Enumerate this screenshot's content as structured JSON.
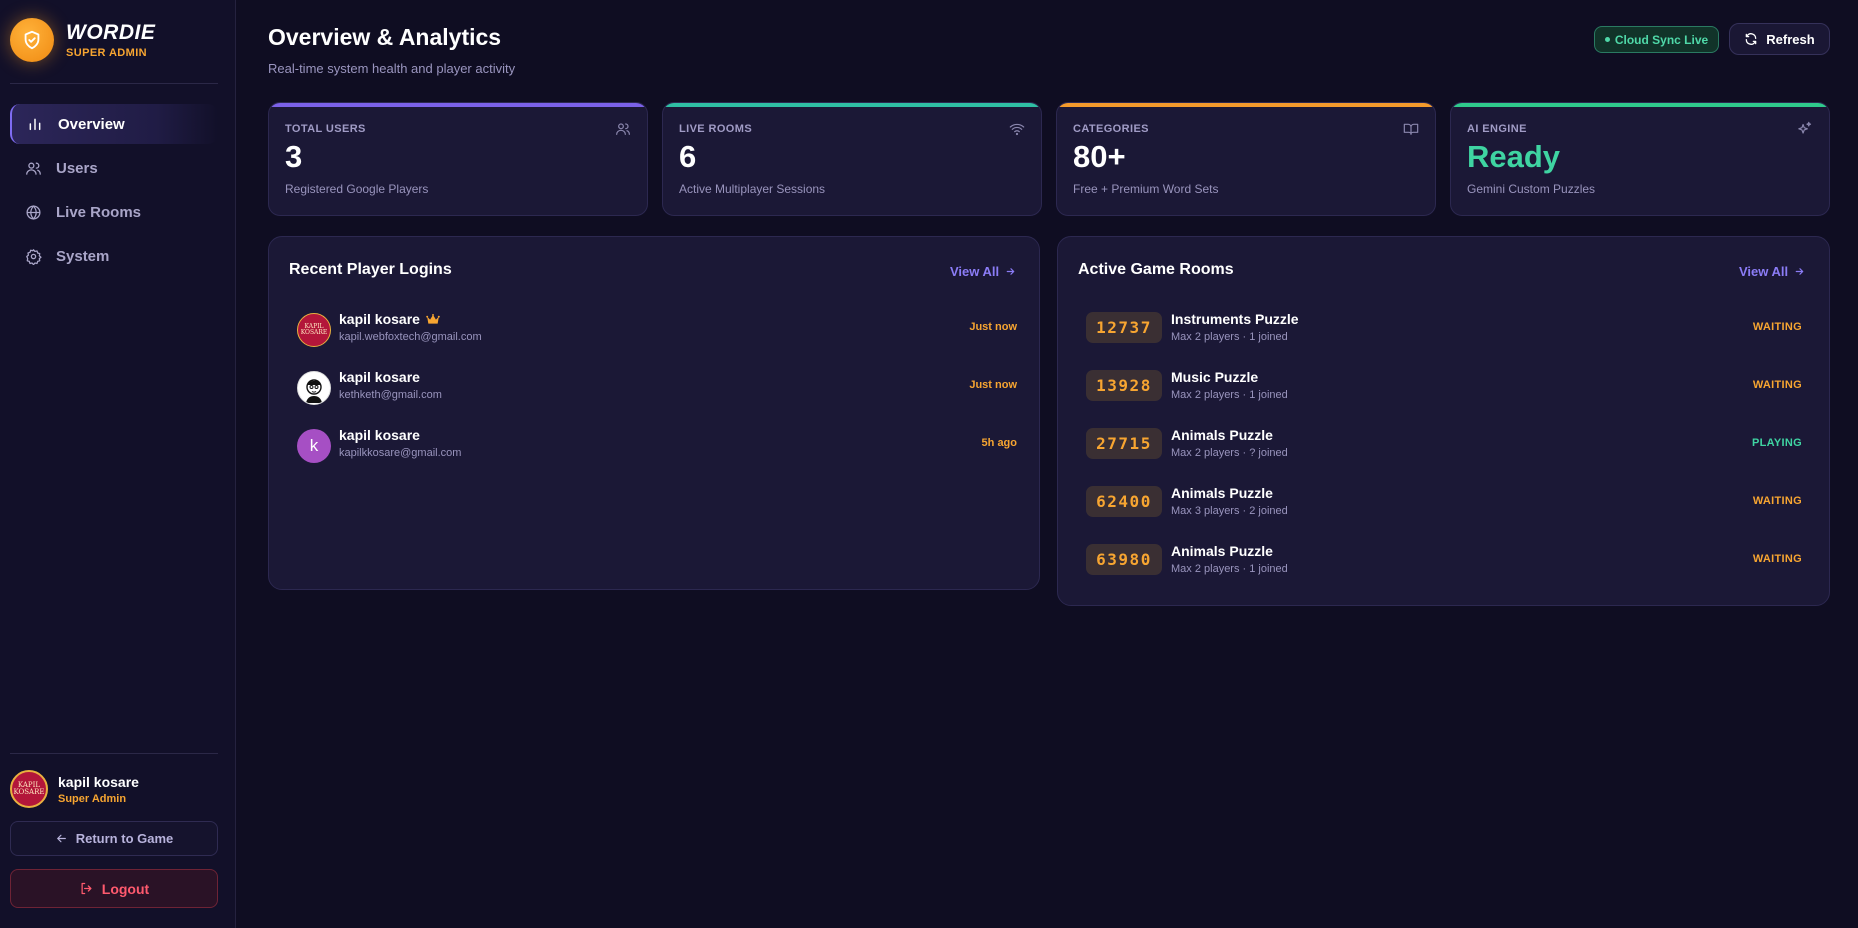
{
  "brand": {
    "name": "WORDIE",
    "role": "SUPER ADMIN"
  },
  "nav": [
    {
      "label": "Overview",
      "icon": "bar-chart-icon",
      "active": true
    },
    {
      "label": "Users",
      "icon": "users-icon",
      "active": false
    },
    {
      "label": "Live Rooms",
      "icon": "globe-icon",
      "active": false
    },
    {
      "label": "System",
      "icon": "gear-icon",
      "active": false
    }
  ],
  "current_user": {
    "name": "kapil kosare",
    "role": "Super Admin",
    "avatar_text": "KAPIL KOSARE"
  },
  "sidebar_actions": {
    "return_label": "Return to Game",
    "logout_label": "Logout"
  },
  "header": {
    "title": "Overview & Analytics",
    "subtitle": "Real-time system health and player activity",
    "sync_label": "Cloud Sync Live",
    "refresh_label": "Refresh"
  },
  "stats": [
    {
      "label": "TOTAL USERS",
      "value": "3",
      "desc": "Registered Google Players",
      "icon": "users-icon",
      "accent": "#7b61e8"
    },
    {
      "label": "LIVE ROOMS",
      "value": "6",
      "desc": "Active Multiplayer Sessions",
      "icon": "wifi-icon",
      "accent": "#2fbfa4"
    },
    {
      "label": "CATEGORIES",
      "value": "80+",
      "desc": "Free + Premium Word Sets",
      "icon": "book-icon",
      "accent": "#f39a2c"
    },
    {
      "label": "AI ENGINE",
      "value": "Ready",
      "desc": "Gemini Custom Puzzles",
      "icon": "sparkles-icon",
      "accent": "#2fc98c"
    }
  ],
  "recent_logins": {
    "title": "Recent Player Logins",
    "view_all": "View All",
    "items": [
      {
        "name": "kapil kosare",
        "email": "kapil.webfoxtech@gmail.com",
        "time": "Just now",
        "crown": true,
        "avatar": "logo"
      },
      {
        "name": "kapil kosare",
        "email": "kethketh@gmail.com",
        "time": "Just now",
        "crown": false,
        "avatar": "sketch"
      },
      {
        "name": "kapil kosare",
        "email": "kapilkkosare@gmail.com",
        "time": "5h ago",
        "crown": false,
        "avatar": "letter",
        "initial": "k"
      }
    ]
  },
  "active_rooms": {
    "title": "Active Game Rooms",
    "view_all": "View All",
    "items": [
      {
        "code": "12737",
        "name": "Instruments Puzzle",
        "meta": "Max 2 players · 1 joined",
        "status": "WAITING"
      },
      {
        "code": "13928",
        "name": "Music Puzzle",
        "meta": "Max 2 players · 1 joined",
        "status": "WAITING"
      },
      {
        "code": "27715",
        "name": "Animals Puzzle",
        "meta": "Max 2 players · ? joined",
        "status": "PLAYING"
      },
      {
        "code": "62400",
        "name": "Animals Puzzle",
        "meta": "Max 3 players · 2 joined",
        "status": "WAITING"
      },
      {
        "code": "63980",
        "name": "Animals Puzzle",
        "meta": "Max 2 players · 1 joined",
        "status": "WAITING"
      }
    ]
  },
  "colors": {
    "background": "#0f0d22",
    "accent_purple": "#8b7cf6",
    "accent_orange": "#f7a531",
    "status_waiting": "#f7a531",
    "status_playing": "#3fd4a2",
    "danger": "#ff5a6e"
  }
}
